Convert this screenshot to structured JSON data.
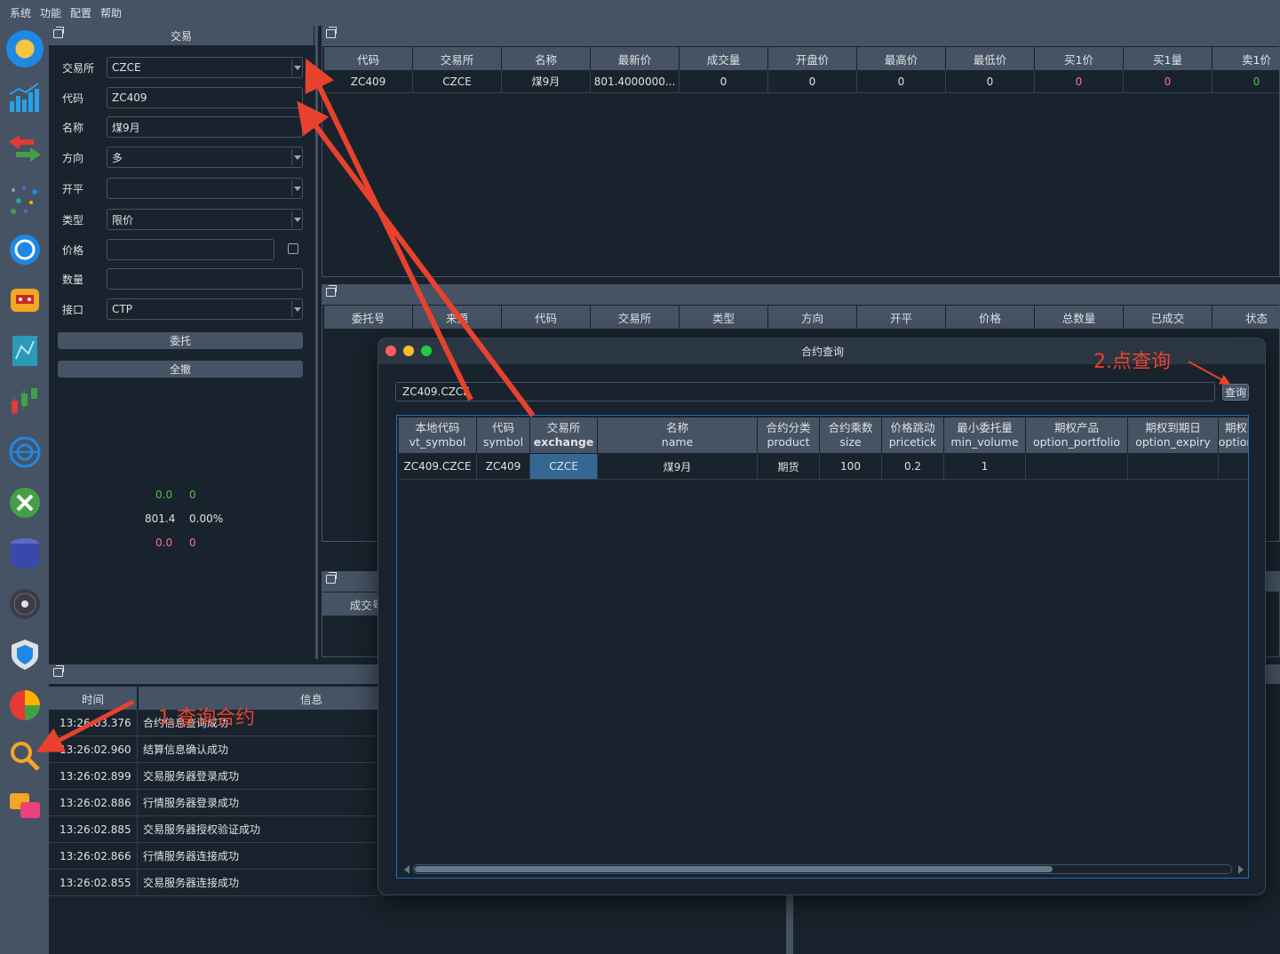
{
  "menu": [
    "系统",
    "功能",
    "配置",
    "帮助"
  ],
  "toolbar_icons": [
    "chess-rook-icon",
    "bar-chart-icon",
    "swap-arrows-icon",
    "scatter-dots-icon",
    "ring-icon",
    "robot-icon",
    "blueprint-icon",
    "candlestick-icon",
    "globe-icon",
    "spreadsheet-icon",
    "database-icon",
    "vinyl-disc-icon",
    "shield-icon",
    "pie-chart-icon",
    "search-icon",
    "chat-bubbles-icon"
  ],
  "trade": {
    "title": "交易",
    "exchange_label": "交易所",
    "exchange_value": "CZCE",
    "symbol_label": "代码",
    "symbol_value": "ZC409",
    "name_label": "名称",
    "name_value": "煤9月",
    "direction_label": "方向",
    "direction_value": "多",
    "offset_label": "开平",
    "offset_value": "",
    "type_label": "类型",
    "type_value": "限价",
    "price_label": "价格",
    "price_value": "",
    "volume_label": "数量",
    "volume_value": "",
    "gateway_label": "接口",
    "gateway_value": "CTP",
    "send_button": "委托",
    "cancel_all_button": "全撤",
    "depth": {
      "bid_price": "0.0",
      "bid_volume": "0",
      "last_price": "801.4",
      "change_pct": "0.00%",
      "ask_price": "0.0",
      "ask_volume": "0"
    }
  },
  "market_table": {
    "headers": [
      "代码",
      "交易所",
      "名称",
      "最新价",
      "成交量",
      "开盘价",
      "最高价",
      "最低价",
      "买1价",
      "买1量",
      "卖1价"
    ],
    "row": [
      "ZC409",
      "CZCE",
      "煤9月",
      "801.4000000...",
      "0",
      "0",
      "0",
      "0",
      "0",
      "0",
      "0"
    ]
  },
  "order_table": {
    "headers": [
      "委托号",
      "来源",
      "代码",
      "交易所",
      "类型",
      "方向",
      "开平",
      "价格",
      "总数量",
      "已成交",
      "状态"
    ]
  },
  "trade_table": {
    "headers": [
      "成交号"
    ]
  },
  "log_table": {
    "headers": [
      "时间",
      "信息"
    ],
    "rows": [
      {
        "time": "13:26:03.376",
        "msg": "合约信息查询成功"
      },
      {
        "time": "13:26:02.960",
        "msg": "结算信息确认成功"
      },
      {
        "time": "13:26:02.899",
        "msg": "交易服务器登录成功"
      },
      {
        "time": "13:26:02.886",
        "msg": "行情服务器登录成功"
      },
      {
        "time": "13:26:02.885",
        "msg": "交易服务器授权验证成功"
      },
      {
        "time": "13:26:02.866",
        "msg": "行情服务器连接成功"
      },
      {
        "time": "13:26:02.855",
        "msg": "交易服务器连接成功"
      }
    ]
  },
  "dialog": {
    "title": "合约查询",
    "query_value": "ZC409.CZCE",
    "query_button": "查询",
    "headers": [
      {
        "cn": "本地代码",
        "en": "vt_symbol"
      },
      {
        "cn": "代码",
        "en": "symbol"
      },
      {
        "cn": "交易所",
        "en": "exchange"
      },
      {
        "cn": "名称",
        "en": "name"
      },
      {
        "cn": "合约分类",
        "en": "product"
      },
      {
        "cn": "合约乘数",
        "en": "size"
      },
      {
        "cn": "价格跳动",
        "en": "pricetick"
      },
      {
        "cn": "最小委托量",
        "en": "min_volume"
      },
      {
        "cn": "期权产品",
        "en": "option_portfolio"
      },
      {
        "cn": "期权到期日",
        "en": "option_expiry"
      },
      {
        "cn": "期权",
        "en": "option"
      }
    ],
    "row": [
      "ZC409.CZCE",
      "ZC409",
      "CZCE",
      "煤9月",
      "期货",
      "100",
      "0.2",
      "1",
      "",
      "",
      ""
    ]
  },
  "annotations": {
    "step1": "1.查询合约",
    "step2": "2.点查询"
  },
  "colors": {
    "background": "#19232d",
    "panel": "#455364",
    "up_green": "#4ec24e",
    "down_pink": "#ff70a0",
    "selection": "#346792",
    "annotation_red": "#e8422e"
  }
}
